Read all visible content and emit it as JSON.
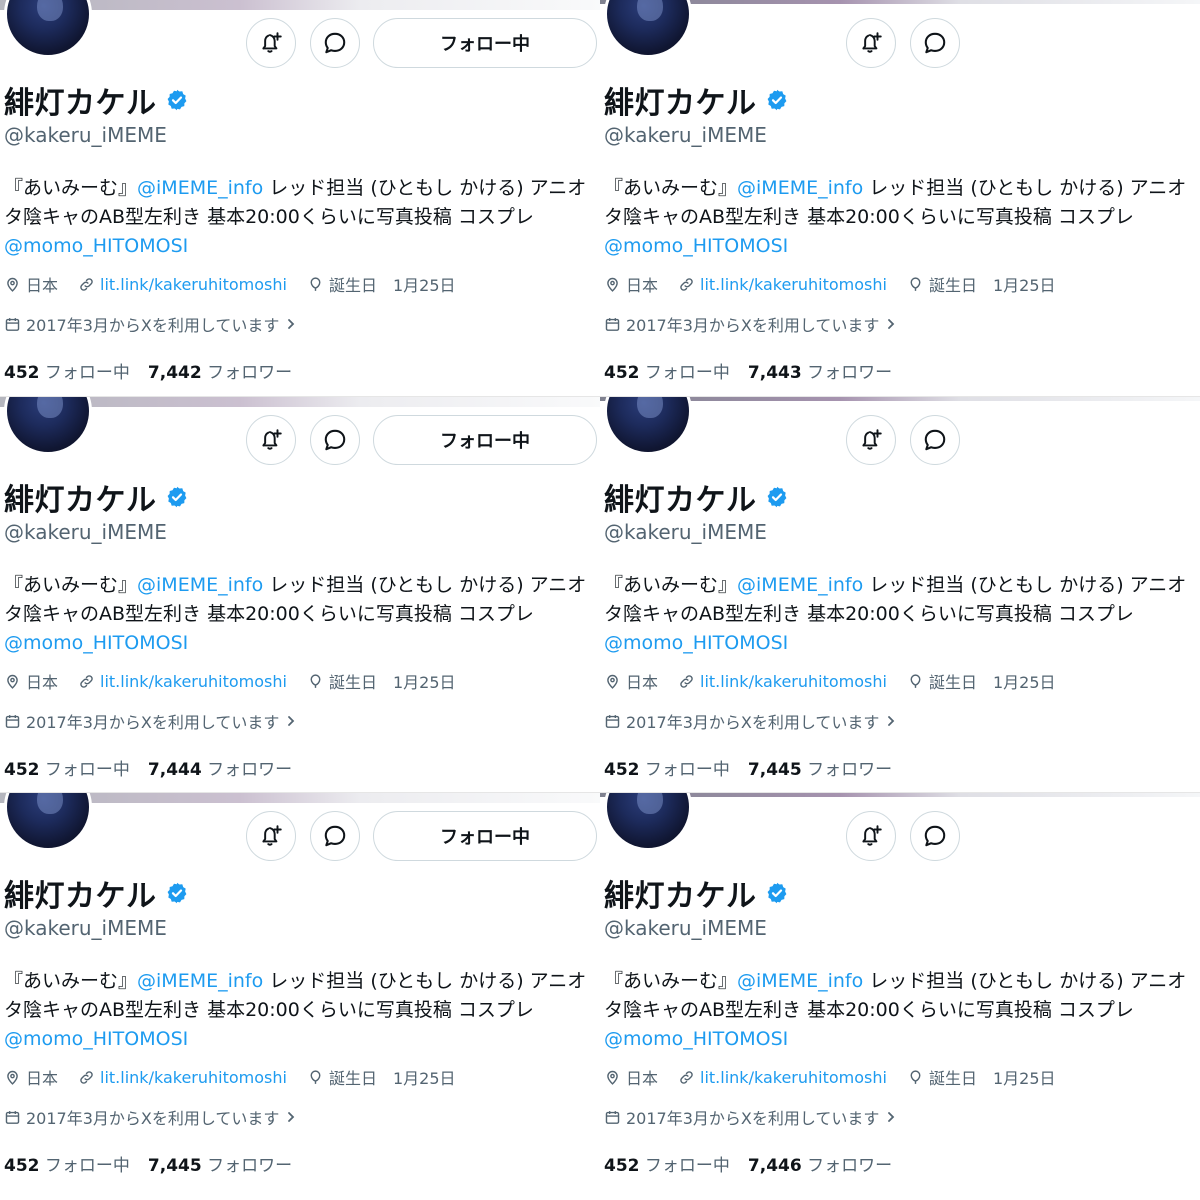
{
  "profile": {
    "display_name": "緋灯カケル",
    "handle": "@kakeru_iMEME",
    "follow_button_label": "フォロー中",
    "bio": {
      "prefix": "『あいみーむ』",
      "mention1": "@iMEME_info",
      "middle": " レッド担当 (ひともし かける) アニオタ陰キャのAB型左利き 基本20:00くらいに写真投稿 コスプレ ",
      "mention2": "@momo_HITOMOSI"
    },
    "location": "日本",
    "website": "lit.link/kakeruhitomoshi",
    "birthday_label": "誕生日",
    "birthday_date": "1月25日",
    "joined": "2017年3月からXを利用しています",
    "following_count": "452",
    "following_label": "フォロー中",
    "followers_label": "フォロワー"
  },
  "panels": [
    {
      "followers_count": "7,442"
    },
    {
      "followers_count": "7,443"
    },
    {
      "followers_count": "7,444"
    },
    {
      "followers_count": "7,445"
    },
    {
      "followers_count": "7,445"
    },
    {
      "followers_count": "7,446"
    }
  ],
  "colors": {
    "accent": "#1d9bf0",
    "secondary_text": "#536471",
    "border": "#cfd9de"
  },
  "icons": [
    "bell-plus-icon",
    "message-icon",
    "verified-badge-icon",
    "location-pin-icon",
    "link-icon",
    "balloon-icon",
    "calendar-icon",
    "chevron-right-icon"
  ]
}
